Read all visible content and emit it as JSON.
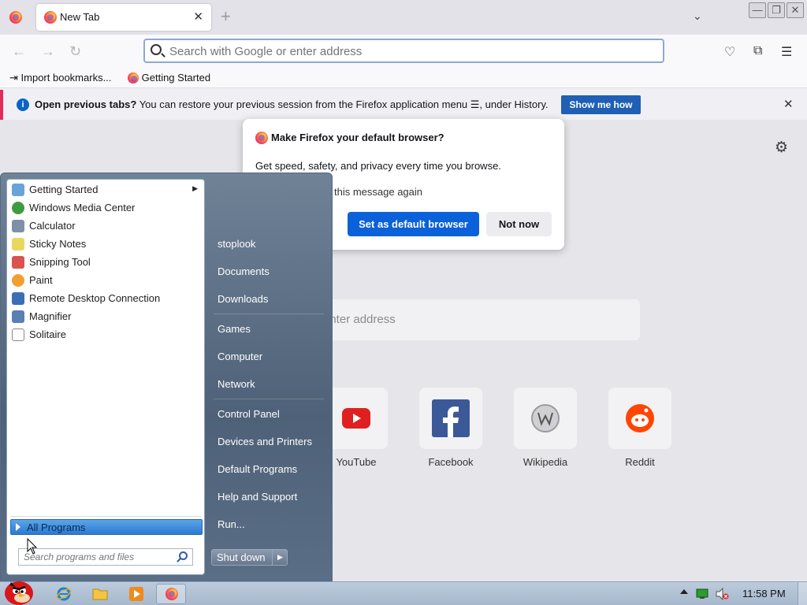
{
  "browser": {
    "tab_title": "New Tab",
    "tab_close": "✕",
    "new_tab": "+",
    "url_placeholder": "Search with Google or enter address",
    "bookmarks": [
      {
        "label": "Import bookmarks...",
        "icon": "import-icon"
      },
      {
        "label": "Getting Started",
        "icon": "firefox-icon"
      }
    ]
  },
  "infobar": {
    "title": "Open previous tabs?",
    "message": "You can restore your previous session from the Firefox application menu ☰, under History.",
    "button": "Show me how",
    "close": "✕"
  },
  "newtab": {
    "search_text": "enter address",
    "shortcuts": [
      {
        "label": "YouTube",
        "icon": "youtube-icon"
      },
      {
        "label": "Facebook",
        "icon": "facebook-icon"
      },
      {
        "label": "Wikipedia",
        "icon": "wikipedia-icon"
      },
      {
        "label": "Reddit",
        "icon": "reddit-icon"
      }
    ]
  },
  "dialog": {
    "title": "Make Firefox your default browser?",
    "body": "Get speed, safety, and privacy every time you browse.",
    "checkbox_text": "this message again",
    "primary": "Set as default browser",
    "secondary": "Not now"
  },
  "startmenu": {
    "programs": [
      {
        "label": "Getting Started",
        "submenu": true,
        "color": "#6aa3d8"
      },
      {
        "label": "Windows Media Center",
        "color": "#3f9b3f"
      },
      {
        "label": "Calculator",
        "color": "#7f8fa6"
      },
      {
        "label": "Sticky Notes",
        "color": "#e8d860"
      },
      {
        "label": "Snipping Tool",
        "color": "#d9534f"
      },
      {
        "label": "Paint",
        "color": "#f0a030"
      },
      {
        "label": "Remote Desktop Connection",
        "color": "#3a6fb5"
      },
      {
        "label": "Magnifier",
        "color": "#5a7fb0"
      },
      {
        "label": "Solitaire",
        "color": "#c0392b"
      }
    ],
    "all_programs": "All Programs",
    "search_placeholder": "Search programs and files",
    "right_items": [
      "stoplook",
      "Documents",
      "Downloads",
      "Games",
      "Computer",
      "Network",
      "Control Panel",
      "Devices and Printers",
      "Default Programs",
      "Help and Support",
      "Run..."
    ],
    "shutdown": "Shut down"
  },
  "taskbar": {
    "clock": "11:58 PM",
    "pinned": [
      "internet-explorer-icon",
      "folder-icon",
      "media-player-icon",
      "firefox-icon"
    ]
  }
}
